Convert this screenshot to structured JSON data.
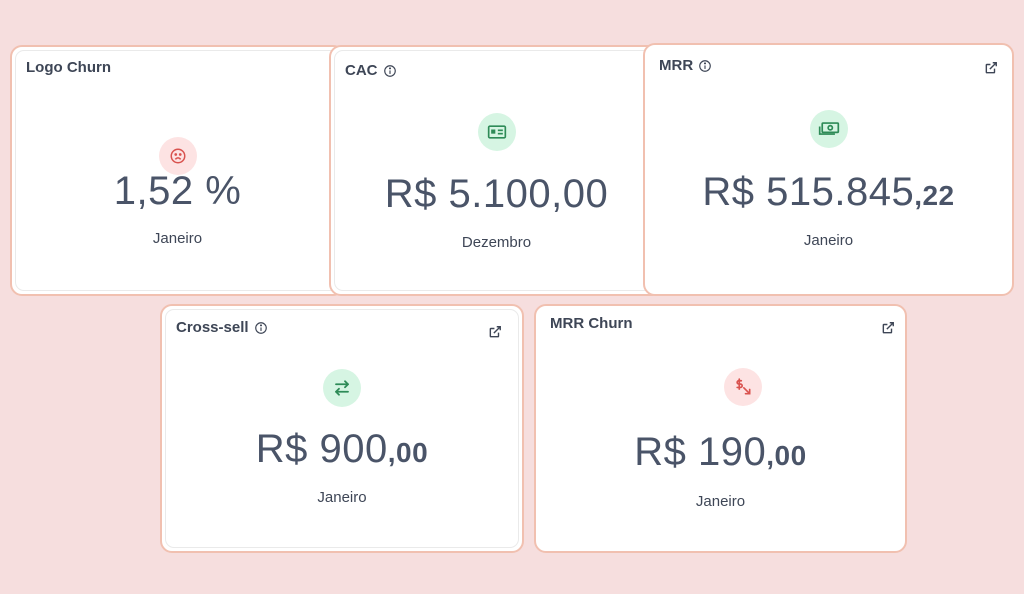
{
  "cards": {
    "logo_churn": {
      "title": "Logo Churn",
      "icon": "sad-face-icon",
      "value": "1,52 %",
      "period": "Janeiro"
    },
    "cac": {
      "title": "CAC",
      "icon": "id-card-icon",
      "value": "R$ 5.100,00",
      "period": "Dezembro"
    },
    "mrr": {
      "title": "MRR",
      "icon": "money-icon",
      "value_main": "R$ 515.845",
      "value_cents": ",22",
      "period": "Janeiro"
    },
    "cross_sell": {
      "title": "Cross-sell",
      "icon": "swap-arrows-icon",
      "value_main": "R$ 900",
      "value_cents": ",00",
      "period": "Janeiro"
    },
    "mrr_churn": {
      "title": "MRR Churn",
      "icon": "dollar-down-icon",
      "value_main": "R$ 190",
      "value_cents": ",00",
      "period": "Janeiro"
    }
  },
  "colors": {
    "background": "#f6dede",
    "card_border": "#f1c0b0",
    "red_badge": "#fde3e3",
    "green_badge": "#d6f5e3",
    "text": "#4a5468"
  }
}
